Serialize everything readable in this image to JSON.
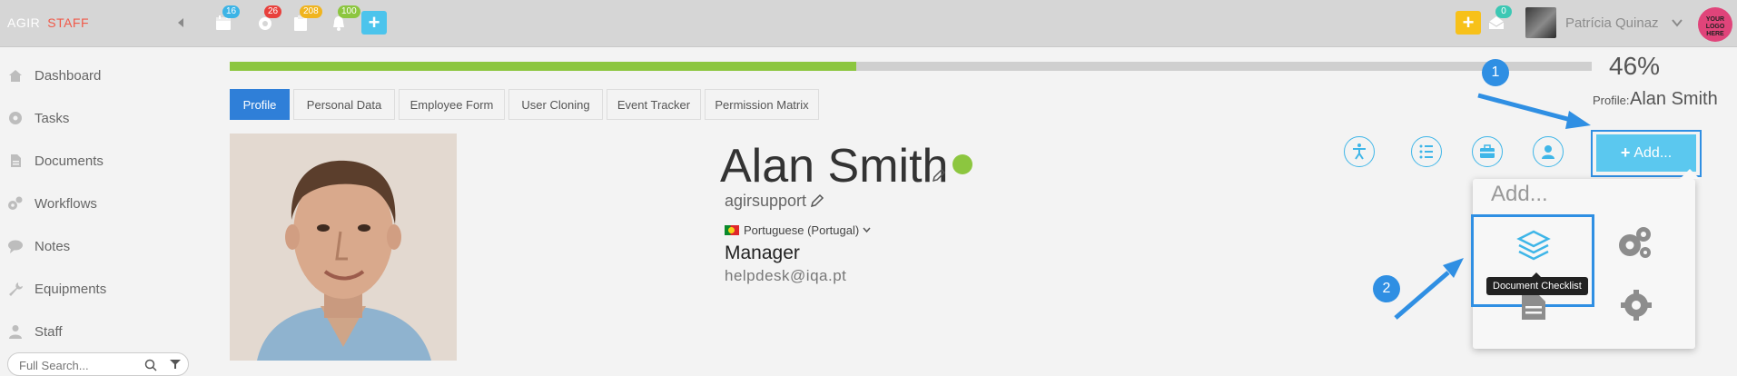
{
  "header": {
    "brand_part1": "AGIR",
    "brand_part2": "STAFF",
    "notifications": [
      {
        "icon": "calendar-icon",
        "count": "16",
        "color": "#3cb4e6"
      },
      {
        "icon": "gear-icon",
        "count": "26",
        "color": "#e8403c"
      },
      {
        "icon": "clipboard-icon",
        "count": "208",
        "color": "#f0b41e"
      },
      {
        "icon": "bell-icon",
        "count": "100",
        "color": "#8cc63f"
      }
    ],
    "quick_add_icon": "plus-icon",
    "right_add_icon": "plus-icon",
    "inbox_icon": "inbox-icon",
    "inbox_count": "0",
    "inbox_badge_color": "#3cc8b4",
    "user_name": "Patrícia Quinaz",
    "logo_text": "YOUR LOGO HERE"
  },
  "sidebar": {
    "items": [
      {
        "label": "Dashboard",
        "icon": "home-icon"
      },
      {
        "label": "Tasks",
        "icon": "gear-icon"
      },
      {
        "label": "Documents",
        "icon": "document-icon"
      },
      {
        "label": "Workflows",
        "icon": "gears-icon"
      },
      {
        "label": "Notes",
        "icon": "chat-icon"
      },
      {
        "label": "Equipments",
        "icon": "wrench-icon"
      },
      {
        "label": "Staff",
        "icon": "user-icon"
      }
    ],
    "search_placeholder": "Full Search..."
  },
  "progress": {
    "percent_value": 46,
    "percent_label": "46%"
  },
  "profile_header": {
    "label": "Profile:",
    "name": "Alan Smith"
  },
  "tabs": [
    {
      "label": "Profile",
      "active": true
    },
    {
      "label": "Personal Data",
      "active": false
    },
    {
      "label": "Employee Form",
      "active": false
    },
    {
      "label": "User Cloning",
      "active": false
    },
    {
      "label": "Event Tracker",
      "active": false
    },
    {
      "label": "Permission Matrix",
      "active": false
    }
  ],
  "profile": {
    "name": "Alan Smith",
    "username": "agirsupport",
    "language": "Portuguese (Portugal)",
    "role": "Manager",
    "email": "helpdesk@iqa.pt",
    "status_color": "#8cc63f"
  },
  "actions": {
    "icons": [
      "accessibility-icon",
      "list-icon",
      "briefcase-icon",
      "user-circle-icon"
    ],
    "add_label": "Add..."
  },
  "dropdown": {
    "title": "Add...",
    "tooltip": "Document Checklist",
    "items": [
      {
        "icon": "layers-icon",
        "label": "Document Checklist"
      },
      {
        "icon": "gears-icon"
      },
      {
        "icon": "document-icon"
      },
      {
        "icon": "gear-icon"
      }
    ]
  },
  "callouts": [
    "1",
    "2"
  ],
  "colors": {
    "accent": "#2f8fe3",
    "tab_active": "#2f7fd8",
    "add_button": "#5bc8ef",
    "progress": "#8cc63f",
    "icon_blue": "#3fb6e8"
  }
}
